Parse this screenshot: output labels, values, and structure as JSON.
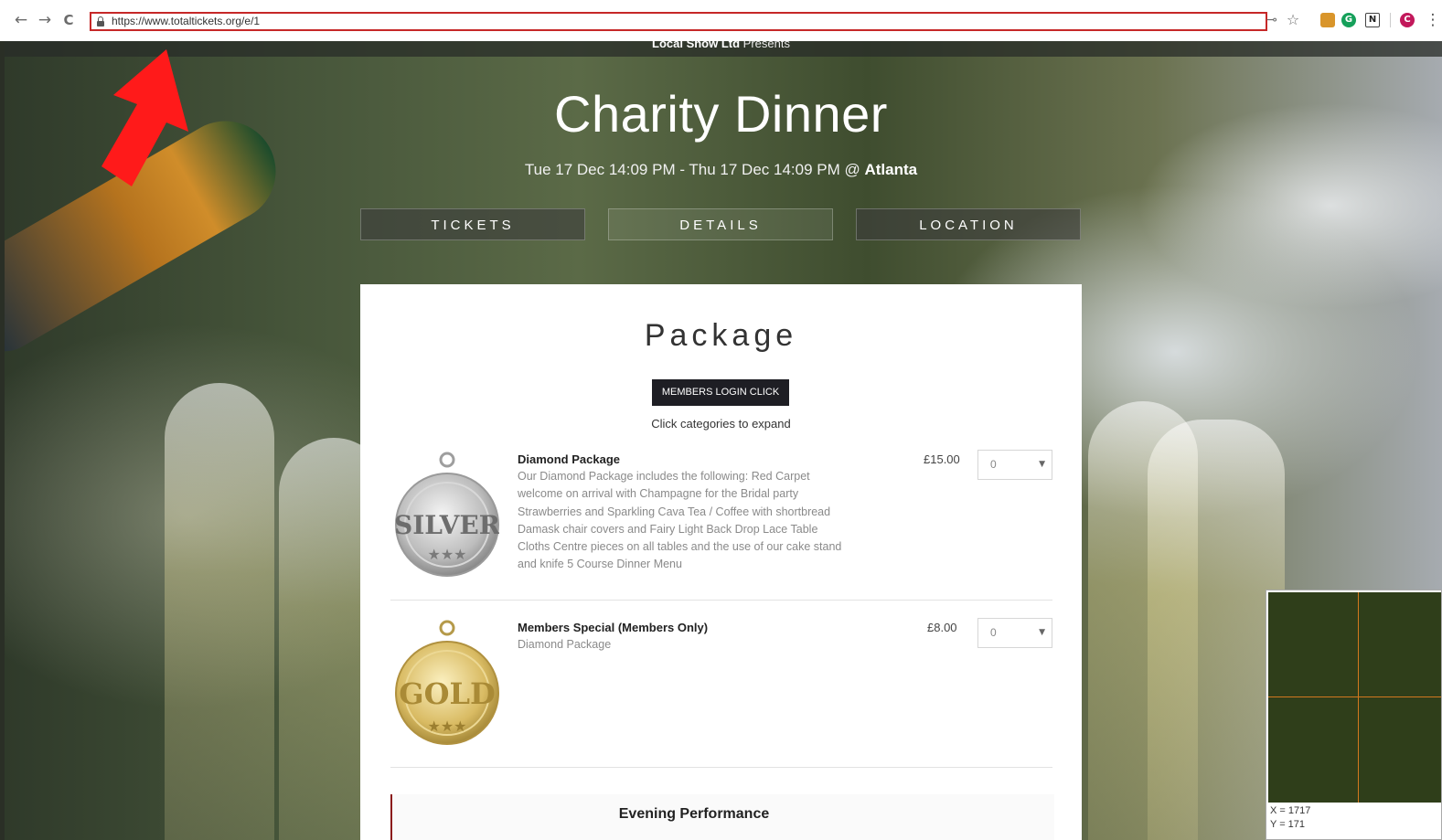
{
  "browser": {
    "url": "https://www.totaltickets.org/e/1",
    "back_icon": "←",
    "forward_icon": "→",
    "reload_icon": "C",
    "star_icon": "☆",
    "key_icon": "⊸",
    "menu_icon": "⋮",
    "profile_initial": "C",
    "ext_grammarly": "G",
    "ext_notion": "N"
  },
  "event": {
    "presenter": "Local Show Ltd",
    "presents_word": " Presents",
    "title": "Charity Dinner",
    "date_range": "Tue 17 Dec 14:09 PM - Thu 17 Dec 14:09 PM @ ",
    "location": "Atlanta"
  },
  "tabs": [
    {
      "label": "TICKETS"
    },
    {
      "label": "DETAILS"
    },
    {
      "label": "LOCATION"
    }
  ],
  "package": {
    "title": "Package",
    "members_login_label": "MEMBERS LOGIN CLICK HERE",
    "expand_hint": "Click categories to expand",
    "items": [
      {
        "name": "Diamond Package",
        "description": "Our Diamond Package includes the following: Red Carpet welcome on arrival with Champagne for the Bridal party Strawberries and Sparkling Cava Tea / Coffee with shortbread Damask chair covers and Fairy Light Back Drop Lace Table Cloths Centre pieces on all tables and the use of our cake stand and knife 5 Course Dinner Menu",
        "price": "£15.00",
        "quantity": "0",
        "medal_text": "SILVER"
      },
      {
        "name": "Members Special (Members Only)",
        "description": "Diamond Package",
        "price": "£8.00",
        "quantity": "0",
        "medal_text": "GOLD"
      }
    ],
    "next_category": "Evening Performance"
  },
  "magnifier": {
    "x_readout": "X = 1717",
    "y_readout": "Y = 171"
  },
  "colors": {
    "annotation_red": "#ff1a1a",
    "omnibox_border": "#c62828",
    "button_dark": "#1e1e24",
    "accent_red": "#8b1c1c"
  }
}
